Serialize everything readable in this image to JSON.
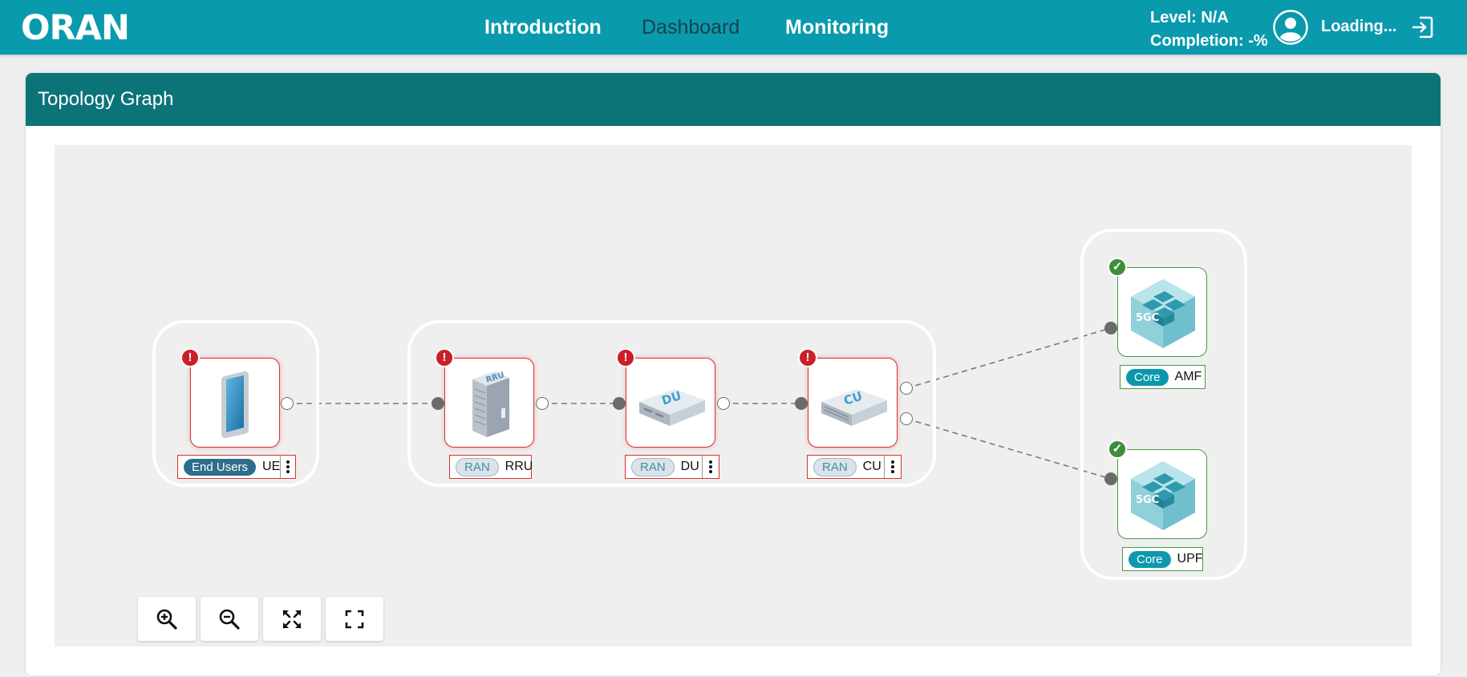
{
  "app": {
    "logo_text": "ORAN"
  },
  "nav": {
    "items": [
      {
        "label": "Introduction"
      },
      {
        "label": "Dashboard",
        "active": true
      },
      {
        "label": "Monitoring"
      }
    ]
  },
  "status": {
    "level": "Level: N/A",
    "completion": "Completion: -%"
  },
  "user": {
    "name": "Loading..."
  },
  "panel": {
    "title": "Topology Graph"
  },
  "graph": {
    "nodes": [
      {
        "id": "ue",
        "category": "End Users",
        "name": "UE",
        "status": "error",
        "icon": "phone-icon",
        "has_menu": true
      },
      {
        "id": "rru",
        "category": "RAN",
        "name": "RRU",
        "status": "error",
        "icon": "rru-icon",
        "icon_text": "RRU",
        "has_menu": false
      },
      {
        "id": "du",
        "category": "RAN",
        "name": "DU",
        "status": "error",
        "icon": "du-icon",
        "icon_text": "DU",
        "has_menu": true
      },
      {
        "id": "cu",
        "category": "RAN",
        "name": "CU",
        "status": "error",
        "icon": "cu-icon",
        "icon_text": "CU",
        "has_menu": true
      },
      {
        "id": "amf",
        "category": "Core",
        "name": "AMF",
        "status": "ok",
        "icon": "5gc-icon",
        "icon_text": "5GC",
        "has_menu": false
      },
      {
        "id": "upf",
        "category": "Core",
        "name": "UPF",
        "status": "ok",
        "icon": "5gc-icon",
        "icon_text": "5GC",
        "has_menu": false
      }
    ],
    "links": [
      [
        "UE",
        "RRU"
      ],
      [
        "RRU",
        "DU"
      ],
      [
        "DU",
        "CU"
      ],
      [
        "CU",
        "AMF"
      ],
      [
        "CU",
        "UPF"
      ]
    ],
    "badges": {
      "error": "!",
      "ok": "✓"
    }
  },
  "controls": [
    {
      "name": "zoom-in",
      "icon": "zoom-in-icon"
    },
    {
      "name": "zoom-out",
      "icon": "zoom-out-icon"
    },
    {
      "name": "fit-view",
      "icon": "fit-icon"
    },
    {
      "name": "fullscreen",
      "icon": "fullscreen-icon"
    }
  ],
  "colors": {
    "header": "#0a9aae",
    "panel_header": "#0c7479",
    "error": "#c9202a",
    "ok": "#3e8e3c"
  }
}
